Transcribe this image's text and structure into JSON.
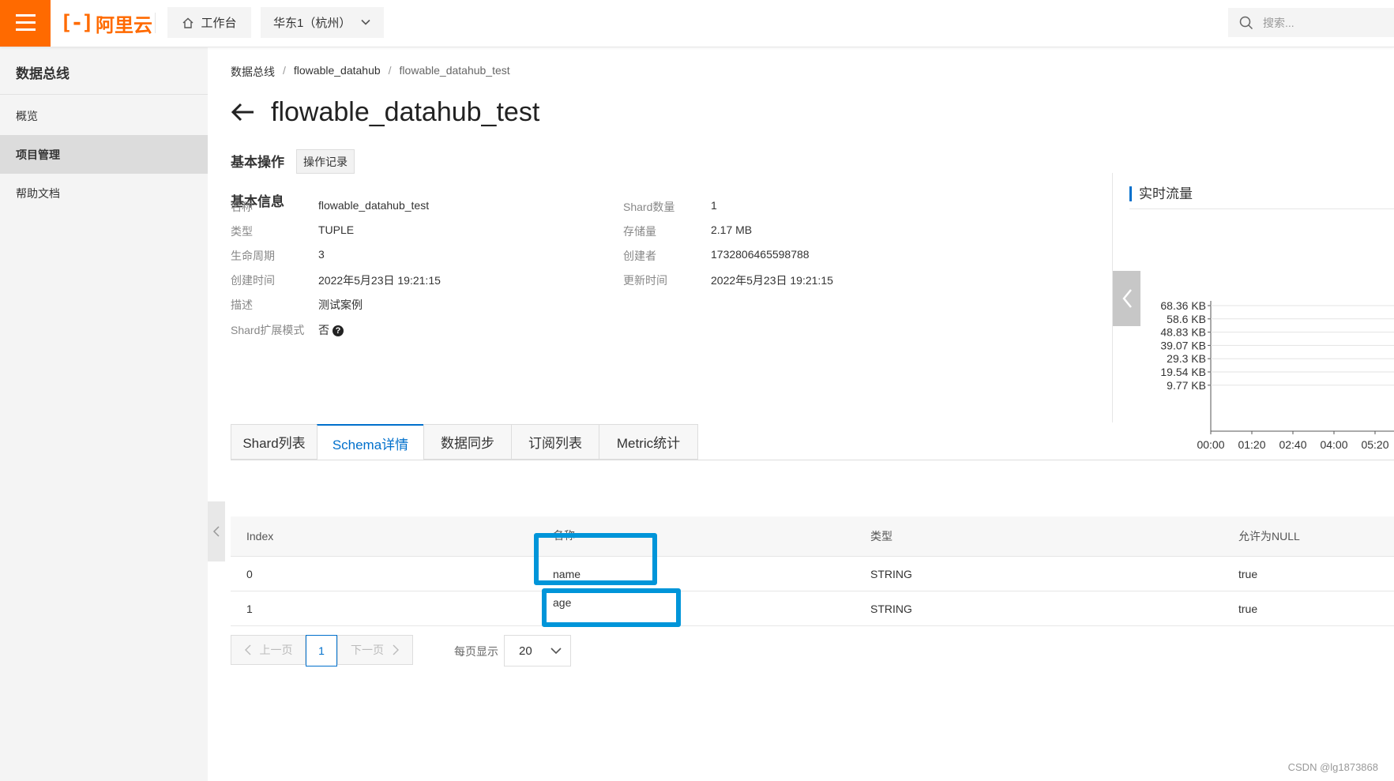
{
  "header": {
    "logo_mark": "[-]",
    "logo_text": "阿里云",
    "workbench_label": "工作台",
    "region_label": "华东1（杭州）",
    "search_placeholder": "搜索..."
  },
  "sidebar": {
    "title": "数据总线",
    "items": [
      {
        "label": "概览",
        "active": false
      },
      {
        "label": "项目管理",
        "active": true
      },
      {
        "label": "帮助文档",
        "active": false
      }
    ]
  },
  "breadcrumb": [
    "数据总线",
    "flowable_datahub",
    "flowable_datahub_test"
  ],
  "page_title": "flowable_datahub_test",
  "operations": {
    "label": "基本操作",
    "log_button": "操作记录"
  },
  "basic_info": {
    "title": "基本信息",
    "left": [
      {
        "label": "名称",
        "value": "flowable_datahub_test"
      },
      {
        "label": "类型",
        "value": "TUPLE"
      },
      {
        "label": "生命周期",
        "value": "3"
      },
      {
        "label": "创建时间",
        "value": "2022年5月23日 19:21:15"
      },
      {
        "label": "描述",
        "value": "测试案例"
      },
      {
        "label": "Shard扩展模式",
        "value": "否"
      }
    ],
    "right": [
      {
        "label": "Shard数量",
        "value": "1"
      },
      {
        "label": "存储量",
        "value": "2.17 MB"
      },
      {
        "label": "创建者",
        "value": "1732806465598788"
      },
      {
        "label": "更新时间",
        "value": "2022年5月23日 19:21:15"
      }
    ]
  },
  "traffic": {
    "title": "实时流量",
    "accent": "#0070cc"
  },
  "chart_data": {
    "type": "line",
    "title": "实时流量",
    "y_tick_labels": [
      "68.36 KB",
      "58.6 KB",
      "48.83 KB",
      "39.07 KB",
      "29.3 KB",
      "19.54 KB",
      "9.77 KB"
    ],
    "x_tick_labels": [
      "00:00",
      "01:20",
      "02:40",
      "04:00",
      "05:20"
    ],
    "grid": true,
    "series": []
  },
  "tabs": [
    {
      "label": "Shard列表",
      "active": false
    },
    {
      "label": "Schema详情",
      "active": true
    },
    {
      "label": "数据同步",
      "active": false
    },
    {
      "label": "订阅列表",
      "active": false
    },
    {
      "label": "Metric统计",
      "active": false
    }
  ],
  "schema_table": {
    "columns": [
      "Index",
      "名称",
      "类型",
      "允许为NULL"
    ],
    "rows": [
      [
        "0",
        "name",
        "STRING",
        "true"
      ],
      [
        "1",
        "age",
        "STRING",
        "true"
      ]
    ]
  },
  "pagination": {
    "prev_label": "上一页",
    "current_page": "1",
    "next_label": "下一页",
    "per_page_label": "每页显示",
    "per_page_value": "20"
  },
  "watermark": "CSDN @lg1873868",
  "colors": {
    "brand": "#ff6a00",
    "primary": "#0070cc",
    "highlight_box": "#0095d9"
  }
}
